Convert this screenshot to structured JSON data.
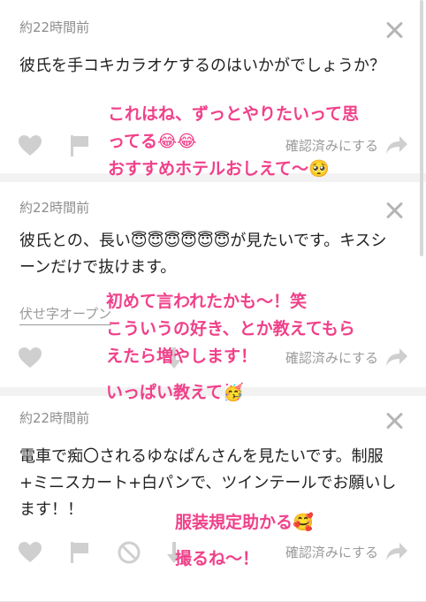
{
  "posts": [
    {
      "time": "約22時間前",
      "question": "彼氏を手コキカラオケするのはいかがでしょうか？",
      "confirm_label": "確認済みにする",
      "answer_lines": [
        "これはね、ずっとやりたいって思",
        "ってる😂😂",
        "おすすめホテルおしえて〜🥺"
      ]
    },
    {
      "time": "約22時間前",
      "question": "彼氏との、長い😇😇😇😇😇😇が見たいです。キスシーンだけで抜けます。",
      "spoiler_label": "伏せ字オープン",
      "confirm_label": "確認済みにする",
      "answer_lines": [
        "初めて言われたかも〜！笑",
        "こういうの好き、とか教えてもら",
        "えたら増やします！",
        "いっぱい教えて🥳"
      ]
    },
    {
      "time": "約22時間前",
      "question": "電車で痴〇されるゆなぱんさんを見たいです。制服+ミニスカート+白パンで、ツインテールでお願いします！！",
      "confirm_label": "確認済みにする",
      "answer_lines": [
        "服装規定助かる🥰",
        "撮るね〜！"
      ]
    }
  ],
  "icons": {
    "like": "heart-icon",
    "report": "flag-icon",
    "block": "block-icon",
    "down": "down-arrow-icon",
    "share": "share-arrow-icon",
    "close": "close-icon"
  },
  "colors": {
    "answer_text": "#f0418a",
    "meta_text": "#8e8e8e",
    "icon_gray": "#cfcfcf"
  }
}
